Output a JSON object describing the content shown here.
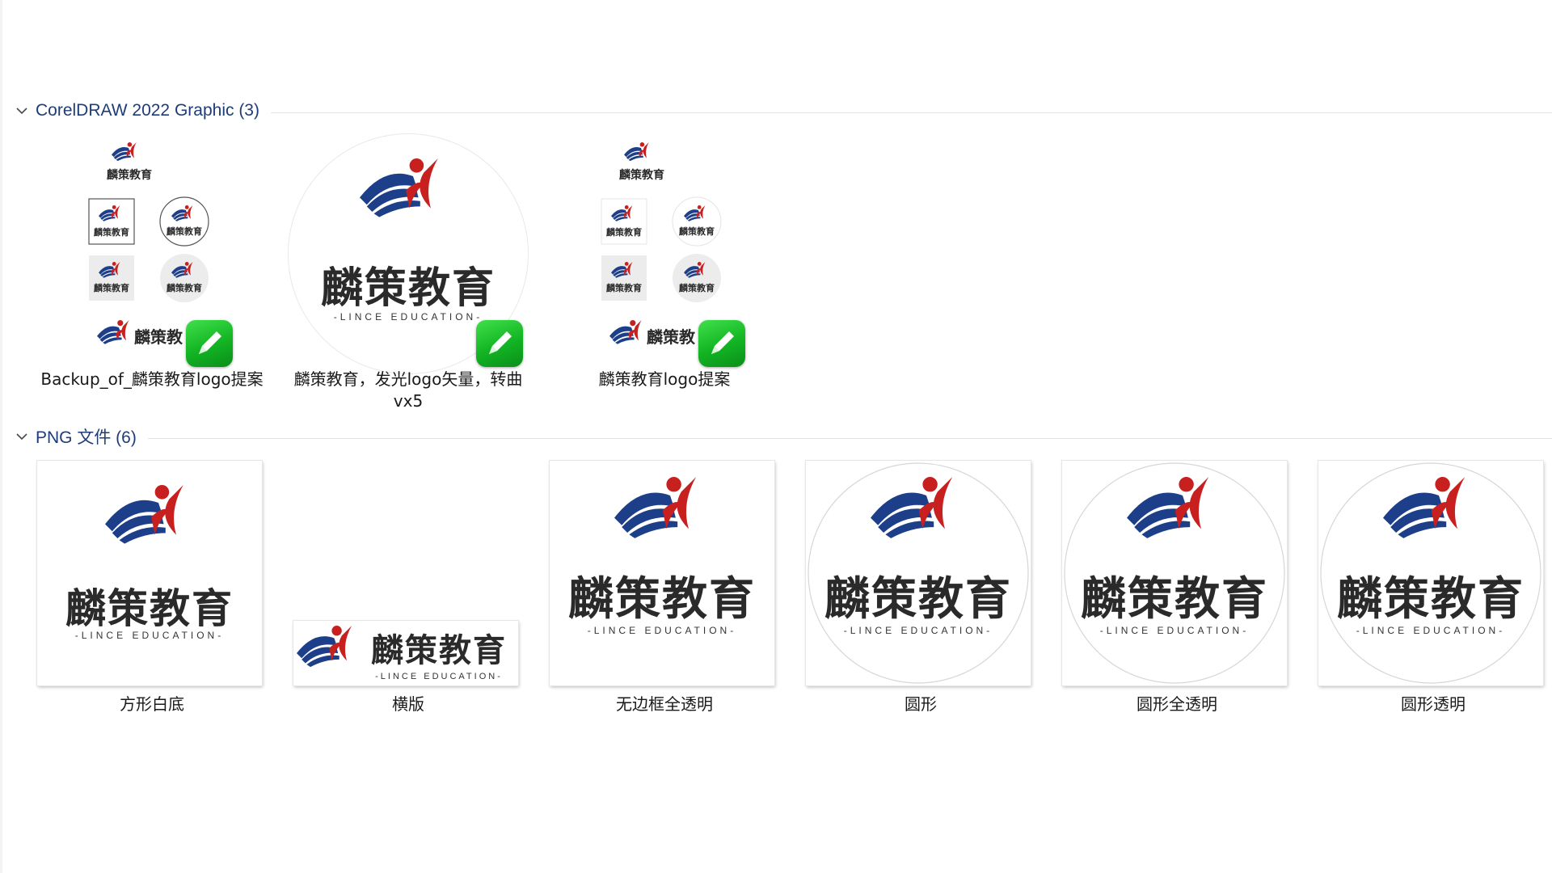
{
  "groups": [
    {
      "title": "CorelDRAW 2022 Graphic (3)",
      "items": [
        {
          "name": "Backup_of_麟策教育logo提案"
        },
        {
          "name": "麟策教育，发光logo矢量，转曲vx5"
        },
        {
          "name": "麟策教育logo提案"
        }
      ]
    },
    {
      "title": "PNG 文件 (6)",
      "items": [
        {
          "name": "方形白底"
        },
        {
          "name": "横版"
        },
        {
          "name": "无边框全透明"
        },
        {
          "name": "圆形"
        },
        {
          "name": "圆形全透明"
        },
        {
          "name": "圆形透明"
        }
      ]
    }
  ],
  "logo": {
    "cn": "麟策教育",
    "en": "-LINCE EDUCATION-"
  },
  "colors": {
    "group_title": "#1e3c78",
    "logo_red": "#c8201f",
    "logo_blue": "#1d3f8a",
    "badge_green": "#12b423"
  },
  "icons": {
    "group_toggle": "chevron-down-icon",
    "app_badge": "coreldraw-badge-icon"
  }
}
